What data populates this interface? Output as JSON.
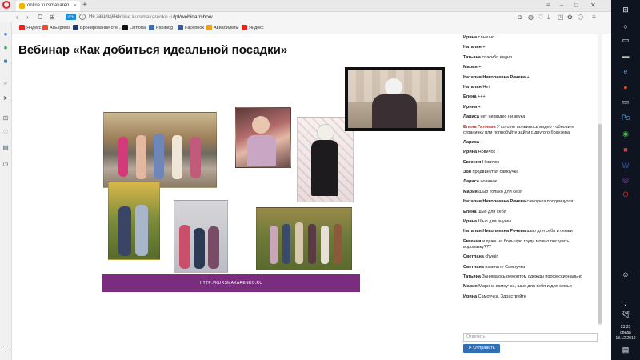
{
  "browser": {
    "tab_title": "online.kursmakarenko.ru/p",
    "tab_close": "×",
    "new_tab": "+",
    "security_badge": "VPN",
    "insecure_label": "Не защищено",
    "url_domain": "online.kursmakarenko.ru",
    "url_path": "/pl/webinar/show",
    "back": "‹",
    "forward": "›",
    "reload": "C",
    "grid": "⊞"
  },
  "bookmarks": [
    {
      "label": "Яндекс",
      "color": "#e52620"
    },
    {
      "label": "AliExpress",
      "color": "#e8512a"
    },
    {
      "label": "Бронирование оте...",
      "color": "#1a3a7a"
    },
    {
      "label": "Lamoda",
      "color": "#111111"
    },
    {
      "label": "Pasiblog",
      "color": "#3a6fb8"
    },
    {
      "label": "Facebook",
      "color": "#3b5998"
    },
    {
      "label": "Авиабилеты",
      "color": "#f0a020"
    },
    {
      "label": "Яндекс",
      "color": "#e52620"
    }
  ],
  "page": {
    "title": "Вебинар «Как добиться идеальной посадки»",
    "banner_text": "HTTP://KURSMAKARENKO.RU"
  },
  "chat": {
    "messages": [
      {
        "name": "Ирина",
        "text": "слышно",
        "highlight": false
      },
      {
        "name": "Наталья",
        "text": "+",
        "highlight": false
      },
      {
        "name": "Татьяна",
        "text": "спасибо видно",
        "highlight": false
      },
      {
        "name": "Мария",
        "text": "+",
        "highlight": false
      },
      {
        "name": "Наталия Николаевна Рочева",
        "text": "+",
        "highlight": false
      },
      {
        "name": "Наталья",
        "text": "Нет",
        "highlight": false
      },
      {
        "name": "Елена",
        "text": "+++",
        "highlight": false
      },
      {
        "name": "Ирина",
        "text": "+",
        "highlight": false
      },
      {
        "name": "Лариса",
        "text": "нет ни видео ни звука",
        "highlight": false
      },
      {
        "name": "Елена Гиляева",
        "text": "У кого не появилось видео - обновите страничку или попробуйте зайти с другого браузера",
        "highlight": true
      },
      {
        "name": "Лариса",
        "text": "+",
        "highlight": false
      },
      {
        "name": "Ирина",
        "text": "Новичок",
        "highlight": false
      },
      {
        "name": "Евгения",
        "text": "Новичок",
        "highlight": false
      },
      {
        "name": "Зоя",
        "text": "продвинутая самоучка",
        "highlight": false
      },
      {
        "name": "Лариса",
        "text": "новичок",
        "highlight": false
      },
      {
        "name": "Мария",
        "text": "Шью только для себя",
        "highlight": false
      },
      {
        "name": "Наталия Николаевна Рочева",
        "text": "самоучка продвинутая",
        "highlight": false
      },
      {
        "name": "Елена",
        "text": "шью для себя",
        "highlight": false
      },
      {
        "name": "Ирина",
        "text": "Шью для внучек",
        "highlight": false
      },
      {
        "name": "Наталия Николаевна Рочева",
        "text": "шью для себя и семьи",
        "highlight": false
      },
      {
        "name": "Евгения",
        "text": "и даже на большую грудь можно посадить водолазку???",
        "highlight": false
      },
      {
        "name": "Светлана",
        "text": "сђуеќг",
        "highlight": false
      },
      {
        "name": "Светлана",
        "text": "извините Самоучка",
        "highlight": false
      },
      {
        "name": "Татьяна",
        "text": "Занимаюсь ремонтом одежды профессионально",
        "highlight": false
      },
      {
        "name": "Мария",
        "text": "Марина самоучка, шью для себя и для семьи",
        "highlight": false
      },
      {
        "name": "Ирина",
        "text": "Самоучка. Здраствуйте",
        "highlight": false
      }
    ],
    "input_placeholder": "Ответить",
    "send_label": "Отправить"
  },
  "taskbar": {
    "lang": "РУС",
    "time": "23:35",
    "day": "среда",
    "date": "18.12.2019"
  },
  "colors": {
    "banner": "#7a2d7e",
    "send_button": "#2f6fb6",
    "highlight_name": "#c0302a"
  }
}
